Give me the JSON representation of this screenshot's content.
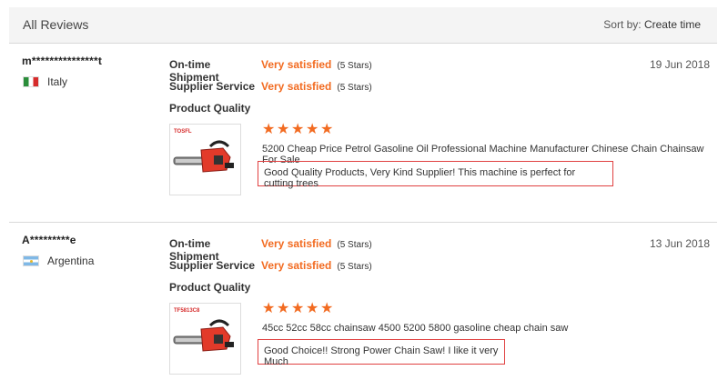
{
  "header": {
    "title": "All Reviews",
    "sort_label": "Sort by:",
    "sort_value": "Create time"
  },
  "reviews": [
    {
      "user": "m***************t",
      "country": "Italy",
      "date": "19 Jun 2018",
      "ratings": [
        {
          "label": "On-time Shipment",
          "value": "Very satisfied",
          "stars_text": "(5 Stars)"
        },
        {
          "label": "Supplier Service",
          "value": "Very satisfied",
          "stars_text": "(5 Stars)"
        }
      ],
      "product_quality_label": "Product Quality",
      "product_stars": 5,
      "product_brand": "TOSFL",
      "product_name": "5200 Cheap Price Petrol Gasoline Oil Professional Machine Manufacturer Chinese Chain Chainsaw For Sale",
      "comment": "Good Quality Products, Very Kind Supplier! This machine is perfect for cutting trees"
    },
    {
      "user": "A*********e",
      "country": "Argentina",
      "date": "13 Jun 2018",
      "ratings": [
        {
          "label": "On-time Shipment",
          "value": "Very satisfied",
          "stars_text": "(5 Stars)"
        },
        {
          "label": "Supplier Service",
          "value": "Very satisfied",
          "stars_text": "(5 Stars)"
        }
      ],
      "product_quality_label": "Product Quality",
      "product_stars": 5,
      "product_brand": "TF5813C8",
      "product_name": "45cc 52cc 58cc chainsaw 4500 5200 5800 gasoline cheap chain saw",
      "comment": "Good Choice!! Strong Power Chain Saw! I like it very Much"
    }
  ],
  "colors": {
    "accent": "#f26b21",
    "comment_border": "#e04040"
  }
}
